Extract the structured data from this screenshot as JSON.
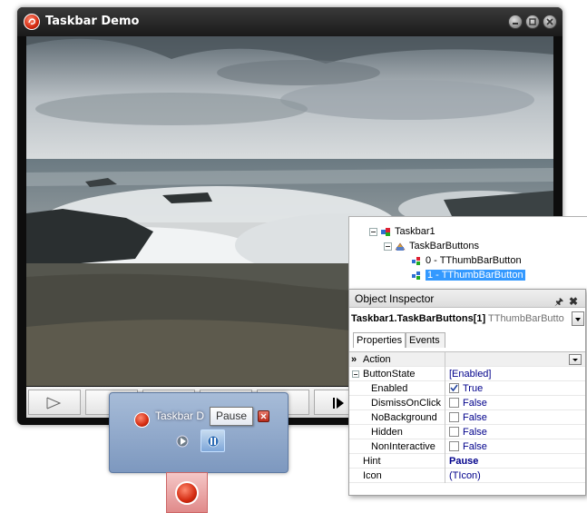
{
  "window": {
    "title": "Taskbar Demo",
    "icon": "app-logo-icon",
    "controls": [
      "minimize-icon",
      "maximize-icon",
      "close-icon"
    ]
  },
  "thumbnail": {
    "title": "Taskbar D",
    "tooltip": "Pause",
    "buttons": [
      "play-icon",
      "pause-icon"
    ]
  },
  "structure": {
    "nodes": [
      "Taskbar1",
      "TaskBarButtons",
      "0 - TThumbBarButton",
      "1 - TThumbBarButton"
    ]
  },
  "inspector": {
    "title": "Object Inspector",
    "selected_object": "Taskbar1.TaskBarButtons[1]",
    "selected_class": "TThumbBarButto",
    "tabs": [
      "Properties",
      "Events"
    ],
    "properties": [
      {
        "name": "Action",
        "value": ""
      },
      {
        "name": "ButtonState",
        "value": "[Enabled]"
      },
      {
        "name": "Enabled",
        "value": "True",
        "checked": true
      },
      {
        "name": "DismissOnClick",
        "value": "False",
        "checked": false
      },
      {
        "name": "NoBackground",
        "value": "False",
        "checked": false
      },
      {
        "name": "Hidden",
        "value": "False",
        "checked": false
      },
      {
        "name": "NonInteractive",
        "value": "False",
        "checked": false
      },
      {
        "name": "Hint",
        "value": "Pause"
      },
      {
        "name": "Icon",
        "value": "(TIcon)"
      }
    ],
    "expand_marker": "»"
  },
  "colors": {
    "selection": "#3399ff",
    "value_text": "#00008b",
    "thumbnail_bg": "#8fa8cc"
  }
}
